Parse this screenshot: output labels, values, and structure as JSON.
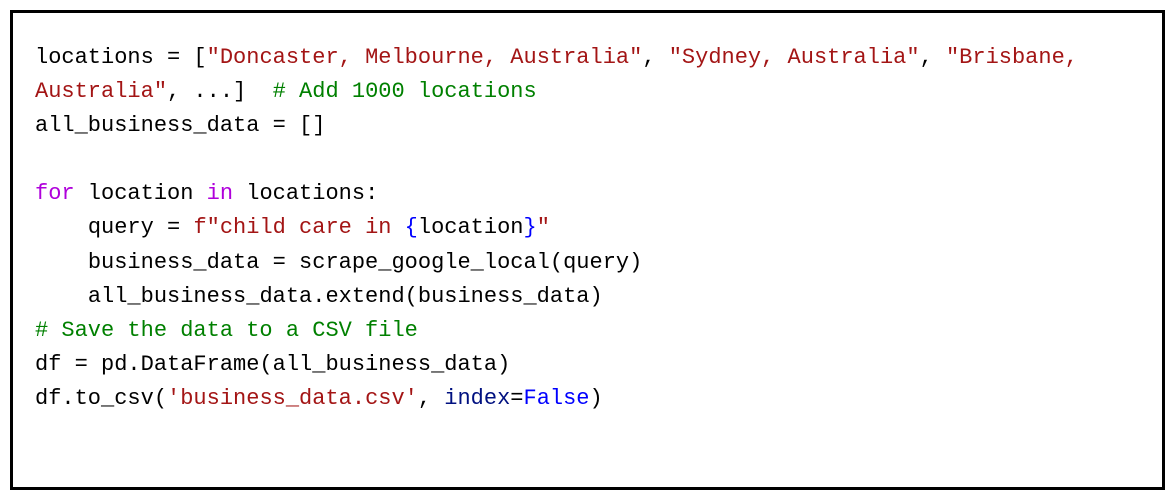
{
  "code": {
    "tokens": [
      {
        "t": "locations = [",
        "c": "tok-default"
      },
      {
        "t": "\"Doncaster, Melbourne, Australia\"",
        "c": "tok-string"
      },
      {
        "t": ", ",
        "c": "tok-default"
      },
      {
        "t": "\"Sydney, Australia\"",
        "c": "tok-string"
      },
      {
        "t": ", ",
        "c": "tok-default"
      },
      {
        "t": "\"Brisbane, Australia\"",
        "c": "tok-string"
      },
      {
        "t": ", ...]  ",
        "c": "tok-default"
      },
      {
        "t": "# Add 1000 locations",
        "c": "tok-comment"
      },
      {
        "t": "\n",
        "c": "tok-default"
      },
      {
        "t": "all_business_data = []",
        "c": "tok-default"
      },
      {
        "t": "\n\n",
        "c": "tok-default"
      },
      {
        "t": "for",
        "c": "tok-control"
      },
      {
        "t": " location ",
        "c": "tok-default"
      },
      {
        "t": "in",
        "c": "tok-control"
      },
      {
        "t": " locations:",
        "c": "tok-default"
      },
      {
        "t": "\n    query = ",
        "c": "tok-default"
      },
      {
        "t": "f\"child care in ",
        "c": "tok-string"
      },
      {
        "t": "{",
        "c": "tok-keyword"
      },
      {
        "t": "location",
        "c": "tok-default"
      },
      {
        "t": "}",
        "c": "tok-keyword"
      },
      {
        "t": "\"",
        "c": "tok-string"
      },
      {
        "t": "\n    business_data = scrape_google_local(query)",
        "c": "tok-default"
      },
      {
        "t": "\n    all_business_data.extend(business_data)",
        "c": "tok-default"
      },
      {
        "t": "\n",
        "c": "tok-default"
      },
      {
        "t": "# Save the data to a CSV file",
        "c": "tok-comment"
      },
      {
        "t": "\n",
        "c": "tok-default"
      },
      {
        "t": "df = pd.DataFrame(all_business_data)",
        "c": "tok-default"
      },
      {
        "t": "\n",
        "c": "tok-default"
      },
      {
        "t": "df.to_csv(",
        "c": "tok-default"
      },
      {
        "t": "'business_data.csv'",
        "c": "tok-string"
      },
      {
        "t": ", ",
        "c": "tok-default"
      },
      {
        "t": "index",
        "c": "tok-label"
      },
      {
        "t": "=",
        "c": "tok-default"
      },
      {
        "t": "False",
        "c": "tok-keyword"
      },
      {
        "t": ")",
        "c": "tok-default"
      }
    ]
  }
}
